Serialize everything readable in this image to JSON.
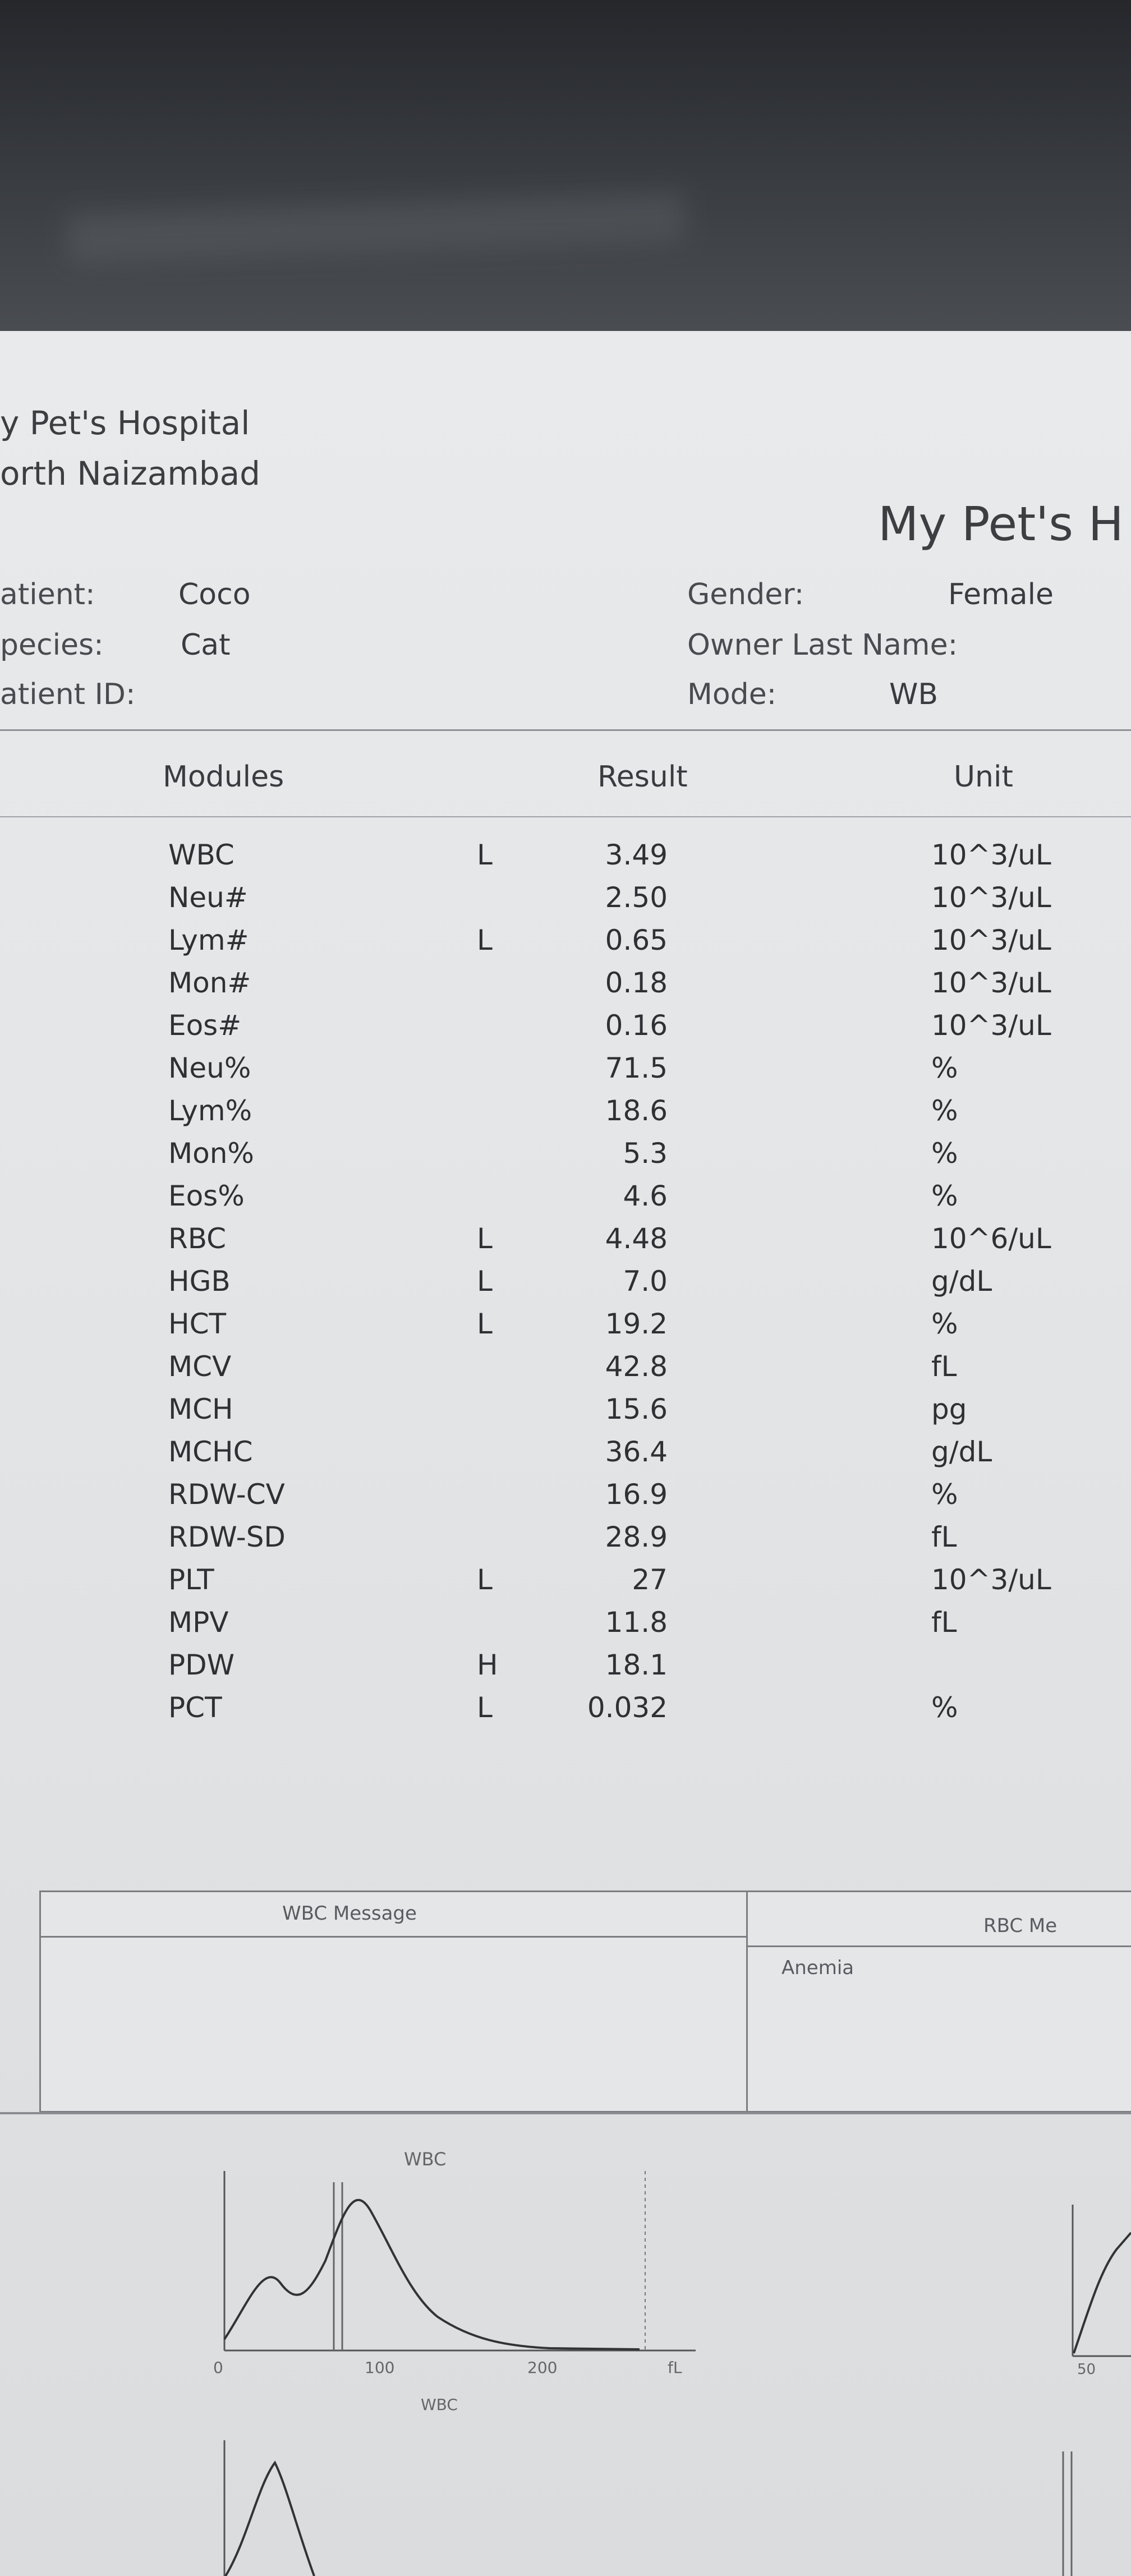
{
  "header": {
    "hospital_line1": "y Pet's Hospital",
    "hospital_line2": "orth Naizambad",
    "hospital_title": "My Pet's H"
  },
  "patient": {
    "patient_label": "atient:",
    "patient_value": "Coco",
    "species_label": "pecies:",
    "species_value": "Cat",
    "id_label": "atient ID:",
    "id_value": "",
    "gender_label": "Gender:",
    "gender_value": "Female",
    "owner_label": "Owner Last Name:",
    "owner_value": "",
    "mode_label": "Mode:",
    "mode_value": "WB"
  },
  "table": {
    "headers": {
      "modules": "Modules",
      "result": "Result",
      "unit": "Unit"
    },
    "rows": [
      {
        "module": "WBC",
        "flag": "L",
        "result": "3.49",
        "unit": "10^3/uL"
      },
      {
        "module": "Neu#",
        "flag": "",
        "result": "2.50",
        "unit": "10^3/uL"
      },
      {
        "module": "Lym#",
        "flag": "L",
        "result": "0.65",
        "unit": "10^3/uL"
      },
      {
        "module": "Mon#",
        "flag": "",
        "result": "0.18",
        "unit": "10^3/uL"
      },
      {
        "module": "Eos#",
        "flag": "",
        "result": "0.16",
        "unit": "10^3/uL"
      },
      {
        "module": "Neu%",
        "flag": "",
        "result": "71.5",
        "unit": "%"
      },
      {
        "module": "Lym%",
        "flag": "",
        "result": "18.6",
        "unit": "%"
      },
      {
        "module": "Mon%",
        "flag": "",
        "result": "5.3",
        "unit": "%"
      },
      {
        "module": "Eos%",
        "flag": "",
        "result": "4.6",
        "unit": "%"
      },
      {
        "module": "RBC",
        "flag": "L",
        "result": "4.48",
        "unit": "10^6/uL"
      },
      {
        "module": "HGB",
        "flag": "L",
        "result": "7.0",
        "unit": "g/dL"
      },
      {
        "module": "HCT",
        "flag": "L",
        "result": "19.2",
        "unit": "%"
      },
      {
        "module": "MCV",
        "flag": "",
        "result": "42.8",
        "unit": "fL"
      },
      {
        "module": "MCH",
        "flag": "",
        "result": "15.6",
        "unit": "pg"
      },
      {
        "module": "MCHC",
        "flag": "",
        "result": "36.4",
        "unit": "g/dL"
      },
      {
        "module": "RDW-CV",
        "flag": "",
        "result": "16.9",
        "unit": "%"
      },
      {
        "module": "RDW-SD",
        "flag": "",
        "result": "28.9",
        "unit": "fL"
      },
      {
        "module": "PLT",
        "flag": "L",
        "result": "27",
        "unit": "10^3/uL"
      },
      {
        "module": "MPV",
        "flag": "",
        "result": "11.8",
        "unit": "fL"
      },
      {
        "module": "PDW",
        "flag": "H",
        "result": "18.1",
        "unit": ""
      },
      {
        "module": "PCT",
        "flag": "L",
        "result": "0.032",
        "unit": "%"
      }
    ]
  },
  "messages": {
    "wbc_title": "WBC Message",
    "rbc_title": "RBC Me",
    "rbc_text": "Anemia"
  },
  "histogram": {
    "label": "WBC",
    "ticks": [
      "0",
      "100",
      "200",
      "fL"
    ],
    "axis_label": "WBC",
    "right_tick": "50"
  },
  "colors": {
    "screen_bg": "#e6e8ea",
    "text": "#2e2f33",
    "bezel": "#25272b"
  }
}
